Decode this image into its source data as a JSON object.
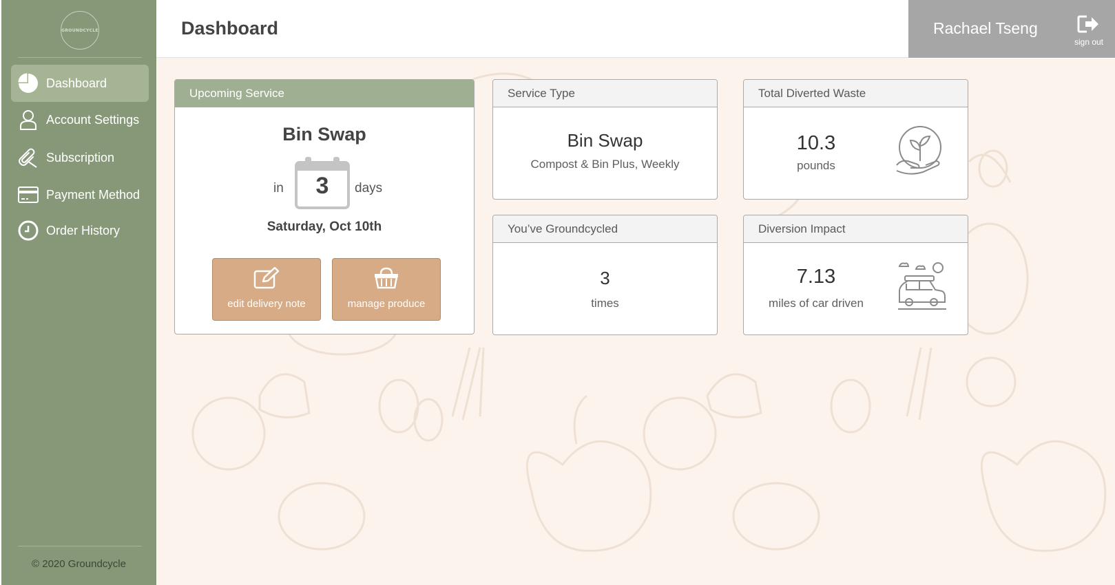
{
  "sidebar": {
    "logo_text": "GROUNDCYCLE",
    "items": [
      {
        "label": "Dashboard",
        "icon": "pie-chart-icon",
        "active": true
      },
      {
        "label": "Account Settings",
        "icon": "user-icon",
        "active": false
      },
      {
        "label": "Subscription",
        "icon": "paperclip-icon",
        "active": false
      },
      {
        "label": "Payment Method",
        "icon": "credit-card-icon",
        "active": false
      },
      {
        "label": "Order History",
        "icon": "clock-icon",
        "active": false
      }
    ],
    "copyright": "© 2020 Groundcycle"
  },
  "header": {
    "title": "Dashboard",
    "user_name": "Rachael Tseng",
    "sign_out_label": "sign out"
  },
  "upcoming": {
    "heading": "Upcoming Service",
    "service_name": "Bin Swap",
    "in_label": "in",
    "days_count": "3",
    "days_label": "days",
    "date": "Saturday, Oct 10th",
    "edit_note_label": "edit delivery note",
    "manage_produce_label": "manage produce"
  },
  "service_type": {
    "heading": "Service Type",
    "value": "Bin Swap",
    "detail": "Compost & Bin Plus, Weekly"
  },
  "diverted": {
    "heading": "Total Diverted Waste",
    "value": "10.3",
    "unit": "pounds",
    "icon": "plant-globe-icon"
  },
  "groundcycled": {
    "heading": "You’ve Groundcycled",
    "value": "3",
    "unit": "times"
  },
  "impact": {
    "heading": "Diversion Impact",
    "value": "7.13",
    "unit": "miles of car driven",
    "icon": "car-icon"
  },
  "colors": {
    "sidebar": "#879878",
    "sidebar_active": "#a6b496",
    "card_header_green": "#9faf92",
    "action_button": "#d6ab85",
    "user_bar": "#a6a6a6",
    "background": "#fcf3ec"
  }
}
